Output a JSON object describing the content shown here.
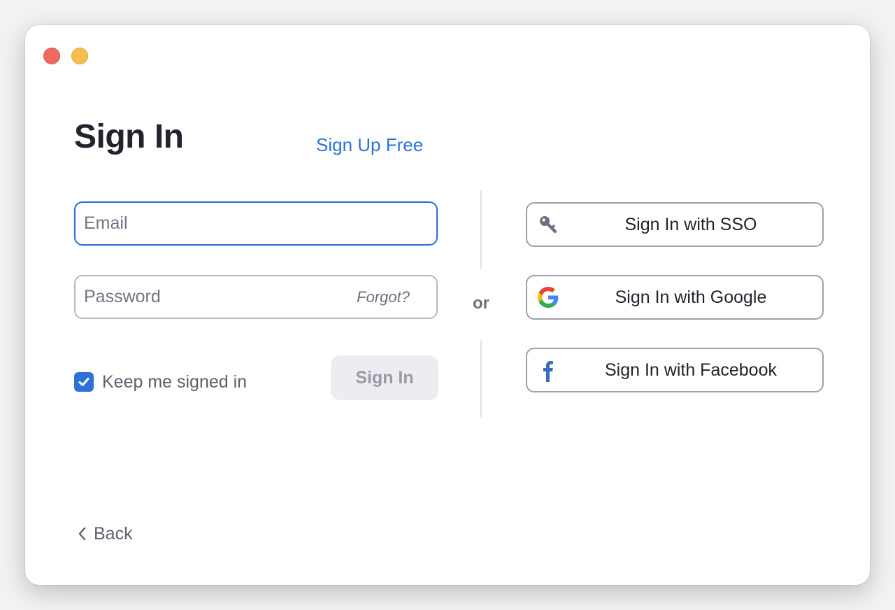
{
  "window": {
    "controls": [
      "close",
      "minimize"
    ]
  },
  "header": {
    "title": "Sign In",
    "signup_link": "Sign Up Free"
  },
  "form": {
    "email": {
      "value": "",
      "placeholder": "Email"
    },
    "password": {
      "value": "",
      "placeholder": "Password",
      "forgot_label": "Forgot?"
    },
    "keep_signed_in": {
      "label": "Keep me signed in",
      "checked": true
    },
    "submit_label": "Sign In"
  },
  "separator": "or",
  "sso_options": [
    {
      "label": "Sign In with SSO",
      "icon": "key-icon"
    },
    {
      "label": "Sign In with Google",
      "icon": "google-icon"
    },
    {
      "label": "Sign In with Facebook",
      "icon": "facebook-icon"
    }
  ],
  "footer": {
    "back_label": "Back",
    "back_icon": "chevron-left-icon"
  },
  "colors": {
    "accent": "#2d72d9",
    "close": "#ee6a5f",
    "minimize": "#f5be4f",
    "facebook": "#3b6dbf",
    "text_dark": "#23232f",
    "text_muted": "#5f5f6f"
  }
}
